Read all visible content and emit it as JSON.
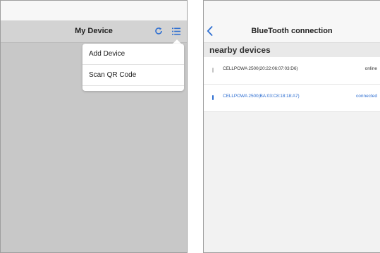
{
  "left_screen": {
    "title": "My Device",
    "icons": {
      "refresh": "refresh-icon",
      "menu": "list-menu-icon"
    },
    "dropdown": {
      "items": [
        {
          "label": "Add Device"
        },
        {
          "label": "Scan QR Code"
        }
      ]
    }
  },
  "right_screen": {
    "title": "BlueTooth connection",
    "back_icon": "chevron-left-icon",
    "section_title": "nearby devices",
    "devices": [
      {
        "name": "CELLPOWA 2500(20:22:06:07:03:D6)",
        "status": "online"
      },
      {
        "name": "CELLPOWA 2500(BA:03:C8:18:18:A7)",
        "status": "connected"
      }
    ]
  },
  "colors": {
    "accent_blue": "#2f6fd1",
    "text_dark": "#222222",
    "left_background": "#c8c8c8",
    "right_background": "#f2f2f2"
  }
}
